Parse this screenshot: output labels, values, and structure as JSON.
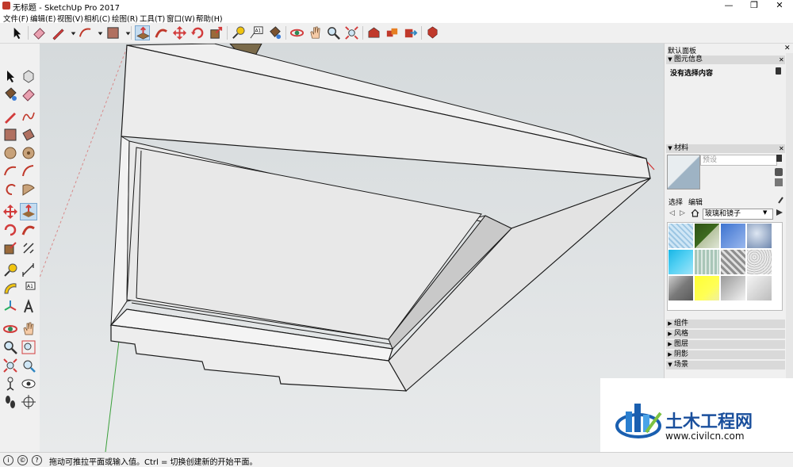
{
  "window": {
    "title": "无标题 - SketchUp Pro 2017",
    "minimize_glyph": "—",
    "maximize_glyph": "❐",
    "close_glyph": "✕"
  },
  "menu": [
    "文件(F)",
    "编辑(E)",
    "视图(V)",
    "相机(C)",
    "绘图(R)",
    "工具(T)",
    "窗口(W)",
    "帮助(H)"
  ],
  "default_panel": {
    "title": "默认面板",
    "entity_info": {
      "title": "图元信息",
      "no_selection": "没有选择内容"
    },
    "materials": {
      "title": "材料",
      "name_placeholder": "预设",
      "tab_select": "选择",
      "tab_edit": "编辑",
      "collection": "玻璃和镜子",
      "swatches": [
        "#cfe6f5",
        "#3d6a1f",
        "#5f8fd8",
        "#8fa6c8",
        "#38c6ee",
        "#a9c6b8",
        "#b9b9b9",
        "#d8d8d8",
        "#8b8b8b",
        "#ffff33",
        "#c9c9c9",
        "#e5e5e5"
      ]
    },
    "collapsed_sections": [
      "组件",
      "风格",
      "图层",
      "阴影",
      "场景"
    ]
  },
  "status": {
    "message": "拖动可推拉平面或输入值。Ctrl = 切换创建新的开始平面。"
  },
  "colors": {
    "viewport_bg": "#e3e6e7",
    "model_face": "#ededed",
    "model_edge": "#1a1a1a",
    "axis_green": "#3aa03a",
    "axis_red": "#d03030",
    "selected_tool": "#c5dcf0"
  },
  "watermark": {
    "title": "土木工程网",
    "url": "www.civilcn.com"
  }
}
